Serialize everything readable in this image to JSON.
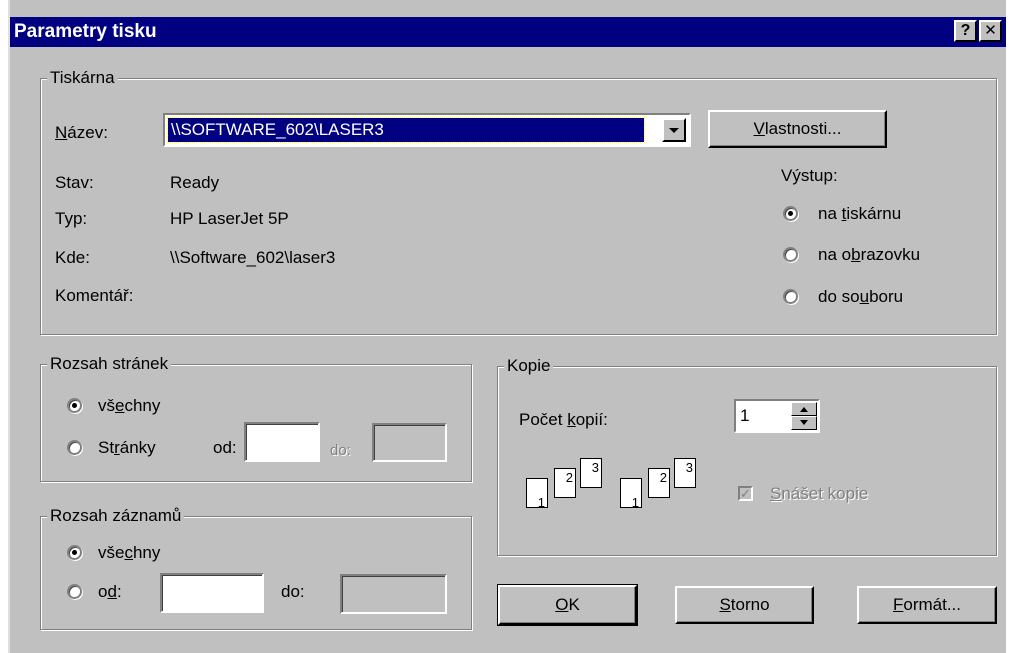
{
  "window": {
    "title": "Parametry tisku",
    "help_btn": "?",
    "close_btn": "✕"
  },
  "printer": {
    "legend": "Tiskárna",
    "name_label": "Název:",
    "name_value": "\\\\SOFTWARE_602\\LASER3",
    "properties_btn": "Vlastnosti...",
    "status_label": "Stav:",
    "status_value": "Ready",
    "type_label": "Typ:",
    "type_value": "HP LaserJet 5P",
    "where_label": "Kde:",
    "where_value": "\\\\Software_602\\laser3",
    "comment_label": "Komentář:"
  },
  "output": {
    "label": "Výstup:",
    "options": [
      {
        "label": "na tiskárnu",
        "selected": true
      },
      {
        "label": "na obrazovku",
        "selected": false
      },
      {
        "label": "do souboru",
        "selected": false
      }
    ]
  },
  "page_range": {
    "legend": "Rozsah stránek",
    "all_label": "všechny",
    "pages_label": "Stránky",
    "from_label": "od:",
    "to_label": "do:",
    "from_value": "",
    "to_value": ""
  },
  "record_range": {
    "legend": "Rozsah záznamů",
    "all_label": "všechny",
    "from_label": "od:",
    "to_label": "do:",
    "from_value": "",
    "to_value": ""
  },
  "copies": {
    "legend": "Kopie",
    "count_label": "Počet kopií:",
    "count_value": "1",
    "collate_label": "Snášet kopie",
    "collate_checked": true,
    "page_numbers": [
      "1",
      "2",
      "3"
    ]
  },
  "buttons": {
    "ok": "OK",
    "cancel": "Storno",
    "format": "Formát..."
  }
}
